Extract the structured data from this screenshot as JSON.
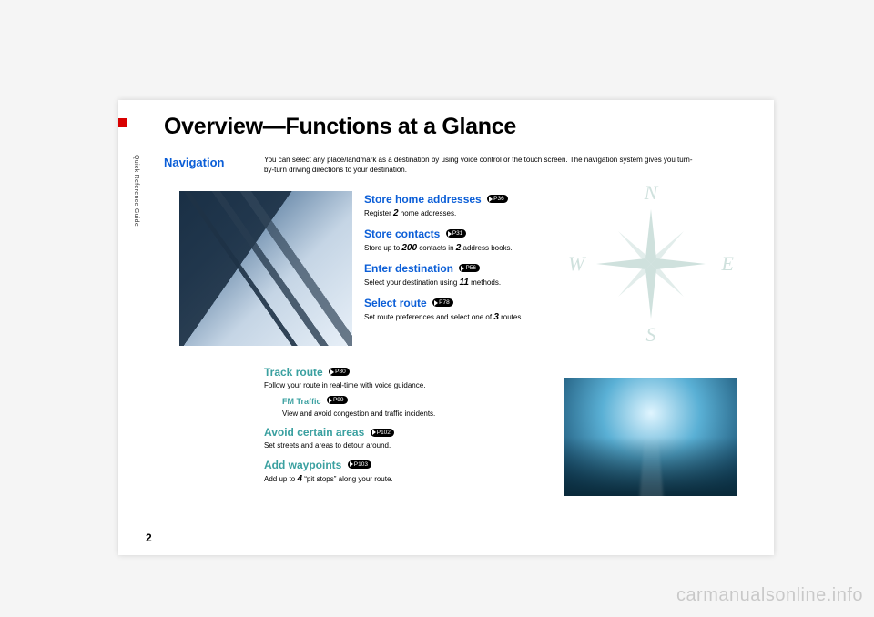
{
  "page": {
    "number": "2",
    "sidebar_label": "Quick Reference Guide",
    "title": "Overview—Functions at a Glance"
  },
  "navigation": {
    "heading": "Navigation",
    "intro": "You can select any place/landmark as a destination by using voice control or the touch screen. The navigation system gives you turn-by-turn driving directions to your destination."
  },
  "compass": {
    "n": "N",
    "e": "E",
    "s": "S",
    "w": "W"
  },
  "features_top": [
    {
      "title": "Store home addresses",
      "page_ref": "P36",
      "desc_pre": "Register ",
      "num1": "2",
      "desc_post": " home addresses."
    },
    {
      "title": "Store contacts",
      "page_ref": "P31",
      "desc_pre": "Store up to ",
      "num1": "200",
      "desc_mid": " contacts in ",
      "num2": "2",
      "desc_post": " address books."
    },
    {
      "title": "Enter destination",
      "page_ref": "P56",
      "desc_pre": "Select your destination using ",
      "num1": "11",
      "desc_post": " methods."
    },
    {
      "title": "Select route",
      "page_ref": "P78",
      "desc_pre": "Set route preferences and select one of ",
      "num1": "3",
      "desc_post": " routes."
    }
  ],
  "features_bottom": {
    "track": {
      "title": "Track route",
      "page_ref": "P80",
      "desc": "Follow your route in real-time with voice guidance.",
      "sub_title": "FM Traffic",
      "sub_page_ref": "P99",
      "sub_desc": "View and avoid congestion and traffic incidents."
    },
    "avoid": {
      "title": "Avoid certain areas",
      "page_ref": "P102",
      "desc": "Set streets and areas to detour around."
    },
    "waypoints": {
      "title": "Add waypoints",
      "page_ref": "P103",
      "desc_pre": "Add up to ",
      "num1": "4",
      "desc_post": " “pit stops” along your route."
    }
  },
  "watermark": "carmanualsonline.info"
}
